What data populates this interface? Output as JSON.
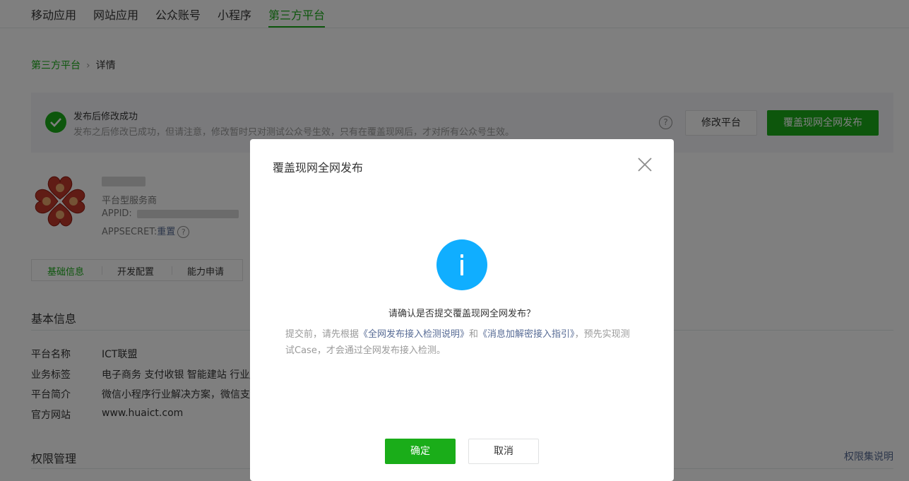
{
  "topnav": {
    "tabs": [
      "移动应用",
      "网站应用",
      "公众账号",
      "小程序",
      "第三方平台"
    ],
    "active_index": 4
  },
  "breadcrumb": {
    "parent": "第三方平台",
    "separator": "›",
    "current": "详情"
  },
  "notice": {
    "icon": "check-circle-icon",
    "title": "发布后修改成功",
    "desc": "发布之后修改已成功，但请注意，修改暂时只对测试公众号生效，只有在覆盖现网后，才对所有公众号生效。",
    "help": "?",
    "edit_button": "修改平台",
    "publish_button": "覆盖现网全网发布"
  },
  "profile": {
    "type": "平台型服务商",
    "appid_label": "APPID:",
    "secret_label": "APPSECRET:",
    "secret_action": "重置",
    "help": "?"
  },
  "subtabs": [
    "基础信息",
    "开发配置",
    "能力申请"
  ],
  "basic_info": {
    "title": "基本信息",
    "rows": [
      {
        "label": "平台名称",
        "value": "ICT联盟"
      },
      {
        "label": "业务标签",
        "value": "电子商务 支付收银 智能建站 行业/"
      },
      {
        "label": "平台简介",
        "value": "微信小程序行业解决方案，微信支"
      },
      {
        "label": "官方网站",
        "value": "www.huaict.com"
      }
    ]
  },
  "permissions": {
    "title": "权限管理",
    "link": "权限集说明"
  },
  "dialog": {
    "title": "覆盖现网全网发布",
    "icon": "info-icon",
    "question": "请确认是否提交覆盖现网全网发布？",
    "desc_prefix": "提交前，请先根据",
    "desc_link1": "《全网发布接入检测说明》",
    "desc_mid": "和",
    "desc_link2": "《消息加解密接入指引》",
    "desc_suffix": "，预先实现测试Case，才会通过全网发布接入检测。",
    "confirm": "确定",
    "cancel": "取消"
  },
  "colors": {
    "accent": "#1aad19",
    "info": "#10aeff",
    "link": "#576b95"
  }
}
